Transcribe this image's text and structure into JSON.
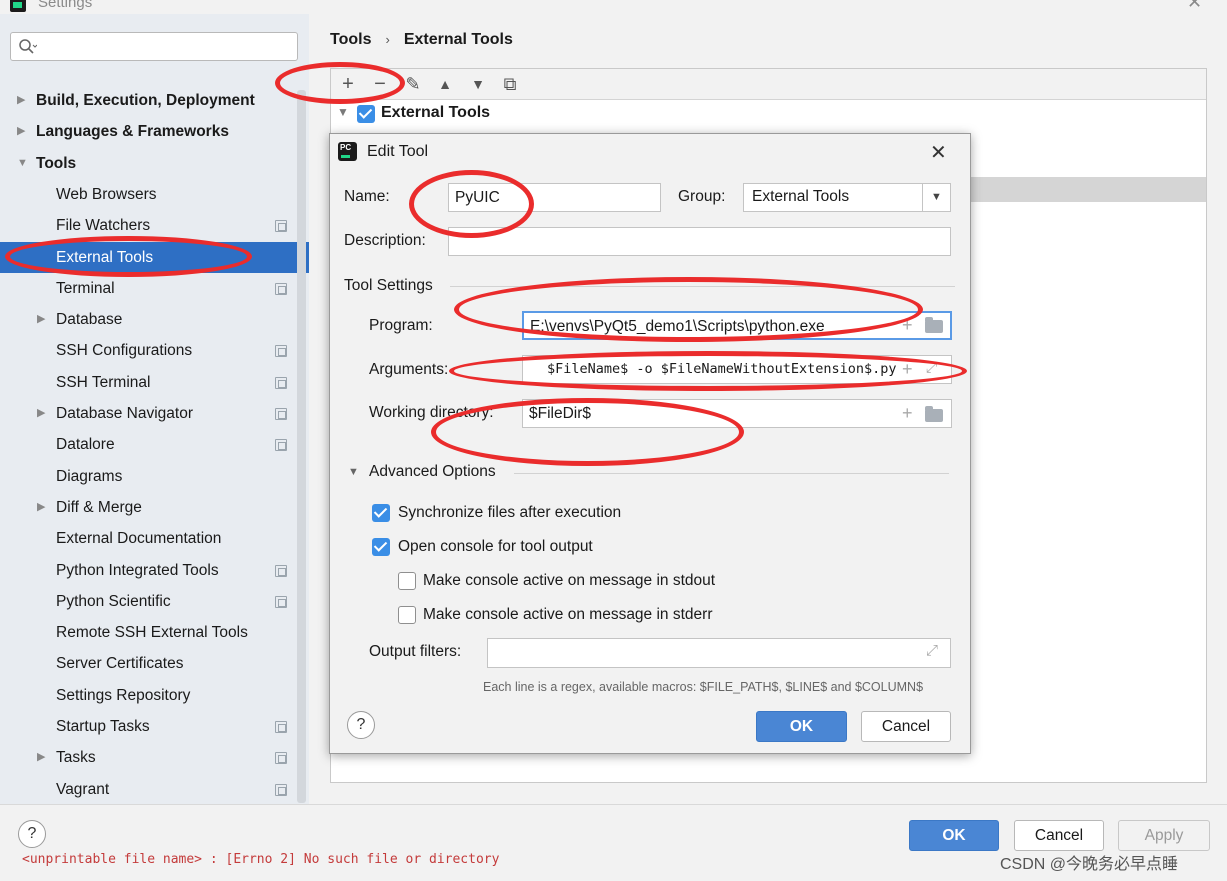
{
  "window": {
    "title": "Settings",
    "close_symbol": "✕"
  },
  "sidebar": {
    "search_placeholder": "",
    "items": [
      {
        "label": "Build, Execution, Deployment",
        "level": 0,
        "expandable": true
      },
      {
        "label": "Languages & Frameworks",
        "level": 0,
        "expandable": true
      },
      {
        "label": "Tools",
        "level": 0,
        "expanded": true
      },
      {
        "label": "Web Browsers",
        "level": 1
      },
      {
        "label": "File Watchers",
        "level": 1,
        "project": true
      },
      {
        "label": "External Tools",
        "level": 1,
        "selected": true
      },
      {
        "label": "Terminal",
        "level": 1,
        "project": true
      },
      {
        "label": "Database",
        "level": 1,
        "expandable": true
      },
      {
        "label": "SSH Configurations",
        "level": 1,
        "project": true
      },
      {
        "label": "SSH Terminal",
        "level": 1,
        "project": true
      },
      {
        "label": "Database Navigator",
        "level": 1,
        "expandable": true,
        "project": true
      },
      {
        "label": "Datalore",
        "level": 1,
        "project": true
      },
      {
        "label": "Diagrams",
        "level": 1
      },
      {
        "label": "Diff & Merge",
        "level": 1,
        "expandable": true
      },
      {
        "label": "External Documentation",
        "level": 1
      },
      {
        "label": "Python Integrated Tools",
        "level": 1,
        "project": true
      },
      {
        "label": "Python Scientific",
        "level": 1,
        "project": true
      },
      {
        "label": "Remote SSH External Tools",
        "level": 1
      },
      {
        "label": "Server Certificates",
        "level": 1
      },
      {
        "label": "Settings Repository",
        "level": 1
      },
      {
        "label": "Startup Tasks",
        "level": 1,
        "project": true
      },
      {
        "label": "Tasks",
        "level": 1,
        "expandable": true,
        "project": true
      },
      {
        "label": "Vagrant",
        "level": 1,
        "project": true
      }
    ]
  },
  "breadcrumb": {
    "parent": "Tools",
    "separator": "›",
    "current": "External Tools"
  },
  "toolbar": {
    "add": "+",
    "remove": "−",
    "edit": "✎",
    "up": "▲",
    "down": "▼",
    "copy": "⧉"
  },
  "tree": {
    "group_label": "External Tools",
    "group_checked": true
  },
  "dialog": {
    "title": "Edit Tool",
    "name_label": "Name:",
    "name_value": "PyUIC",
    "group_label": "Group:",
    "group_value": "External Tools",
    "description_label": "Description:",
    "description_value": "",
    "tool_settings_label": "Tool Settings",
    "program_label": "Program:",
    "program_value": "E:\\venvs\\PyQt5_demo1\\Scripts\\python.exe",
    "arguments_label": "Arguments:",
    "arguments_value": "$FileName$ -o $FileNameWithoutExtension$.py",
    "workdir_label": "Working directory:",
    "workdir_value": "$FileDir$",
    "advanced_label": "Advanced Options",
    "sync_label": "Synchronize files after execution",
    "sync_checked": true,
    "console_label": "Open console for tool output",
    "console_checked": true,
    "stdout_label": "Make console active on message in stdout",
    "stdout_checked": false,
    "stderr_label": "Make console active on message in stderr",
    "stderr_checked": false,
    "output_filters_label": "Output filters:",
    "output_filters_value": "",
    "hint": "Each line is a regex, available macros: $FILE_PATH$, $LINE$ and $COLUMN$",
    "ok_label": "OK",
    "cancel_label": "Cancel",
    "help_symbol": "?"
  },
  "footer": {
    "ok_label": "OK",
    "cancel_label": "Cancel",
    "apply_label": "Apply",
    "help_symbol": "?"
  },
  "console_line": "<unprintable file name> : [Errno 2] No such file or directory",
  "watermark": "CSDN @今晚务必早点睡",
  "colors": {
    "accent": "#3a8ee6",
    "selected": "#2e6fc4",
    "annotation": "#ea2c2c"
  }
}
